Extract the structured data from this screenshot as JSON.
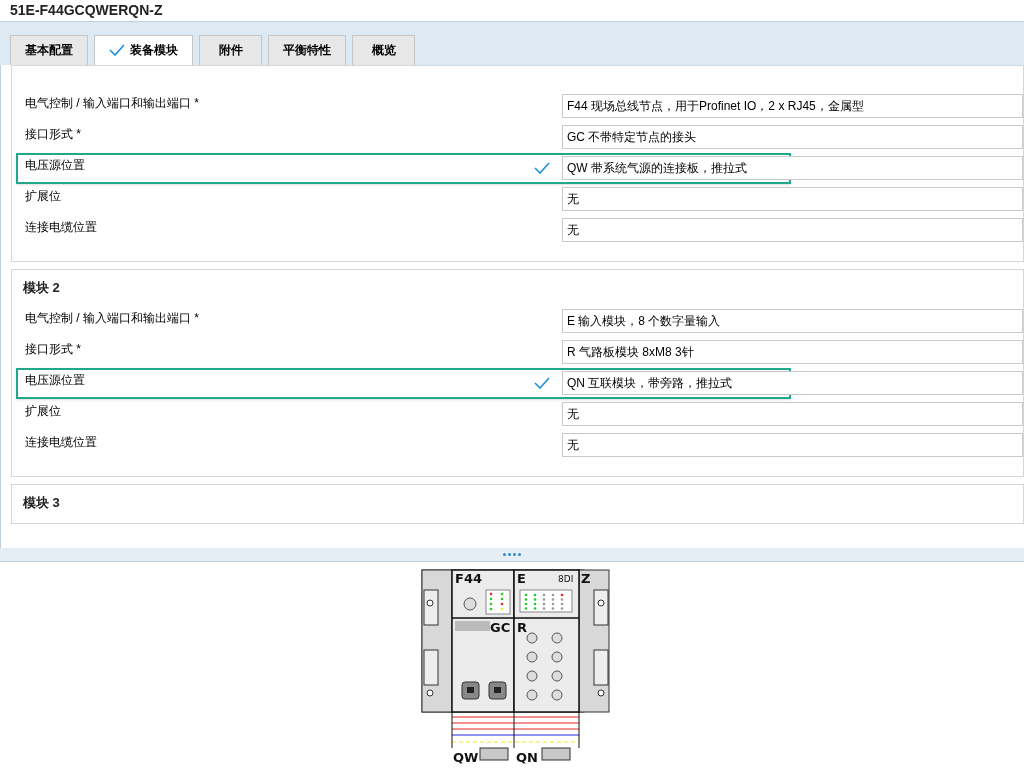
{
  "title": "51E-F44GCQWERQN-Z",
  "tabs": [
    {
      "label": "基本配置",
      "selected": false,
      "checked": false
    },
    {
      "label": "装备模块",
      "selected": true,
      "checked": true
    },
    {
      "label": "附件",
      "selected": false,
      "checked": false
    },
    {
      "label": "平衡特性",
      "selected": false,
      "checked": false
    },
    {
      "label": "概览",
      "selected": false,
      "checked": false
    }
  ],
  "modules": [
    {
      "rows": [
        {
          "label": "电气控制 / 输入端口和输出端口 *",
          "value": "F44 现场总线节点，用于Profinet IO，2 x RJ45，金属型",
          "highlighted": false
        },
        {
          "label": "接口形式 *",
          "value": "GC 不带特定节点的接头",
          "highlighted": false
        },
        {
          "label": "电压源位置",
          "value": "QW 带系统气源的连接板，推拉式",
          "highlighted": true
        },
        {
          "label": "扩展位",
          "value": "无",
          "highlighted": false
        },
        {
          "label": "连接电缆位置",
          "value": "无",
          "highlighted": false
        }
      ]
    },
    {
      "title": "模块 2",
      "rows": [
        {
          "label": "电气控制 / 输入端口和输出端口 *",
          "value": "E 输入模块，8 个数字量输入",
          "highlighted": false
        },
        {
          "label": "接口形式 *",
          "value": "R 气路板模块 8xM8 3针",
          "highlighted": false
        },
        {
          "label": "电压源位置",
          "value": "QN 互联模块，带旁路，推拉式",
          "highlighted": true
        },
        {
          "label": "扩展位",
          "value": "无",
          "highlighted": false
        },
        {
          "label": "连接电缆位置",
          "value": "无",
          "highlighted": false
        }
      ]
    },
    {
      "title": "模块 3"
    }
  ],
  "drawing": {
    "labels": [
      "F44",
      "E",
      "8DI",
      "Z",
      "GC",
      "R",
      "QW",
      "QN"
    ]
  }
}
